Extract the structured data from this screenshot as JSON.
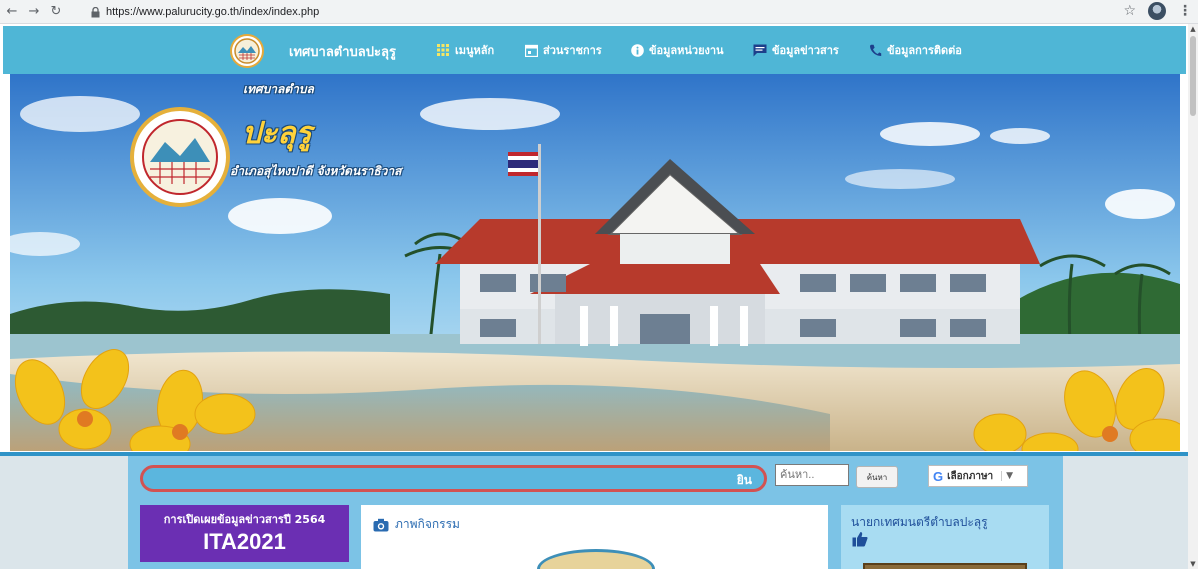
{
  "browser": {
    "url": "https://www.palurucity.go.th/index/index.php",
    "back_icon": "arrow-left-icon",
    "forward_icon": "arrow-right-icon",
    "reload_icon": "reload-icon"
  },
  "nav": {
    "title": "เทศบาลตำบลปะลุรู",
    "items": [
      {
        "icon": "grid-icon",
        "label": "เมนูหลัก"
      },
      {
        "icon": "calendar-icon",
        "label": "ส่วนราชการ"
      },
      {
        "icon": "info-icon",
        "label": "ข้อมูลหน่วยงาน"
      },
      {
        "icon": "chat-icon",
        "label": "ข้อมูลข่าวสาร"
      },
      {
        "icon": "phone-icon",
        "label": "ข้อมูลการติดต่อ"
      }
    ]
  },
  "banner": {
    "name_small": "เทศบาลตำบล",
    "name_large": "ปะลุรู",
    "subtitle": "อำเภอสุไหงปาดี จังหวัดนราธิวาส"
  },
  "toolbar": {
    "marquee_text": "ยิน",
    "search_placeholder": "ค้นหา..",
    "search_button": "ค้นหา",
    "language_label": "เลือกภาษา"
  },
  "ita": {
    "top_text": "การเปิดเผยข้อมูลข่าวสารปี 2564",
    "big_text": "ITA2021"
  },
  "activity": {
    "title": "ภาพกิจกรรม"
  },
  "mayor": {
    "title": "นายกเทศมนตรีตำบลปะลุรู"
  },
  "colors": {
    "nav_bg": "#4fb6d6",
    "ita_bg": "#6b2fb3",
    "marquee_border": "#d25252"
  }
}
